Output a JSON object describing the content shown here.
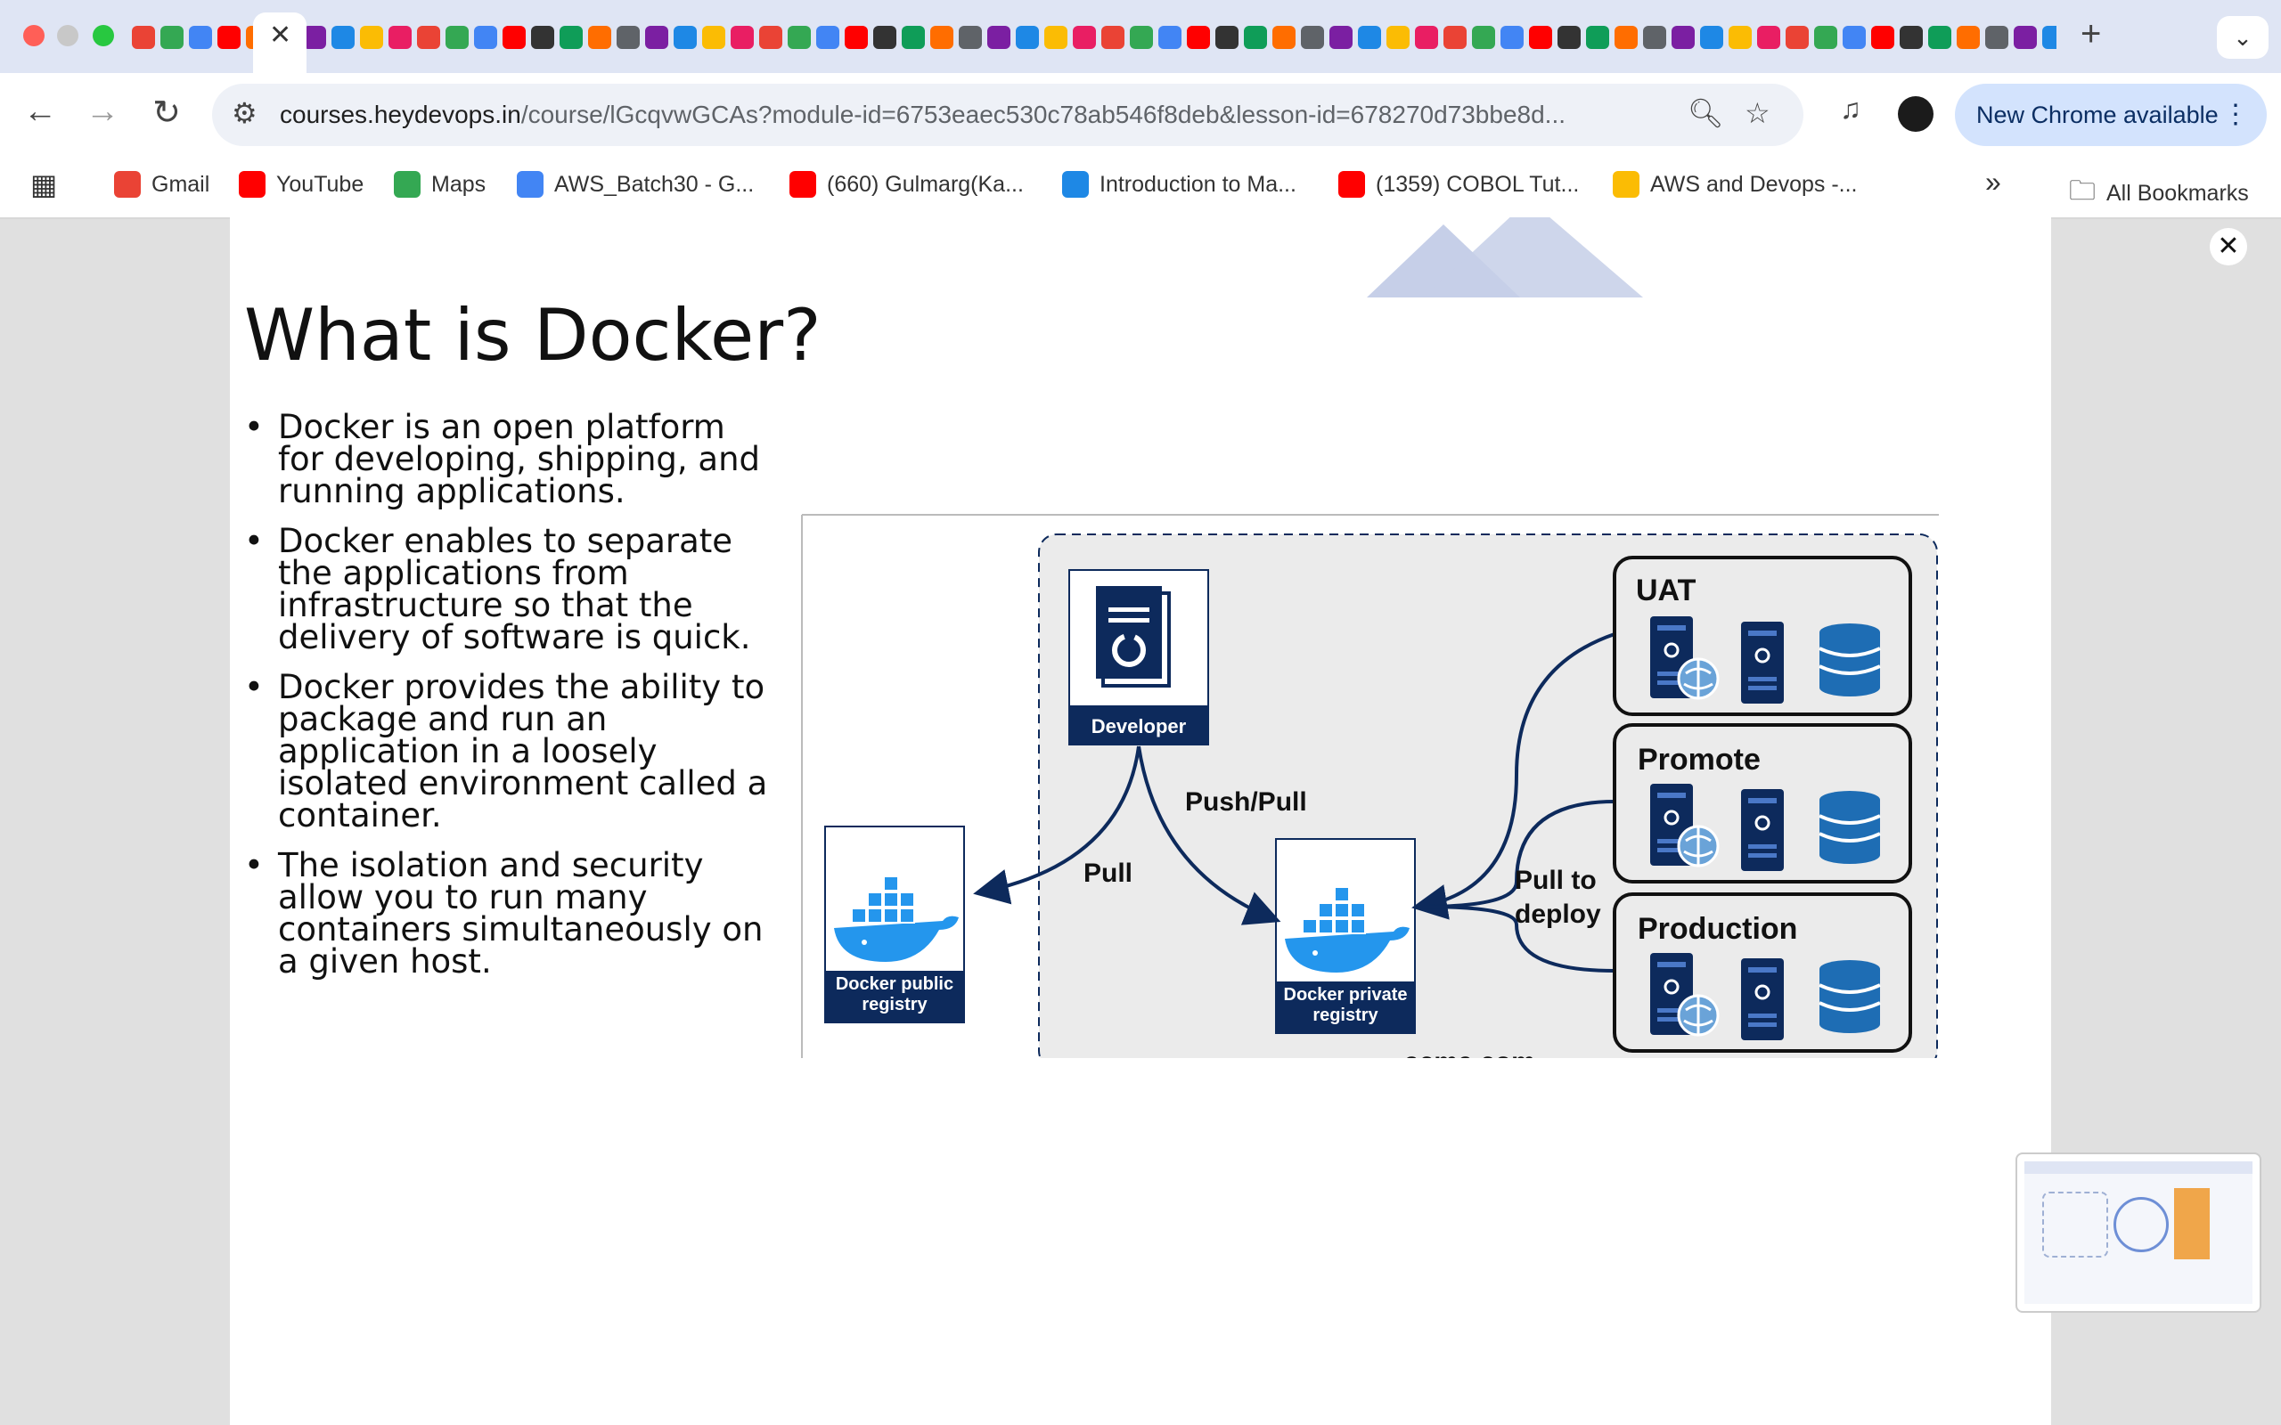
{
  "browser": {
    "tab_close": "✕",
    "new_tab": "+",
    "tab_menu": "⌄",
    "url_host": "courses.heydevops.in",
    "url_path": "/course/lGcqvwGCAs?module-id=6753eaec530c78ab546f8deb&lesson-id=678270d73bbe8d...",
    "new_chrome": "New Chrome available",
    "bookmarks": [
      {
        "label": "Gmail",
        "color": "#ea4335"
      },
      {
        "label": "YouTube",
        "color": "#ff0000"
      },
      {
        "label": "Maps",
        "color": "#34a853"
      },
      {
        "label": "AWS_Batch30 - G...",
        "color": "#4285f4"
      },
      {
        "label": "(660) Gulmarg(Ka...",
        "color": "#ff0000"
      },
      {
        "label": "Introduction to Ma...",
        "color": "#1e88e5"
      },
      {
        "label": "(1359) COBOL Tut...",
        "color": "#ff0000"
      },
      {
        "label": "AWS and Devops -...",
        "color": "#fbbc04"
      }
    ],
    "all_bookmarks": "All Bookmarks",
    "overflow": "»"
  },
  "slide": {
    "title": "What is Docker?",
    "bullets": [
      "Docker is an open platform for developing, shipping, and running applications.",
      "Docker enables to separate the applications from infrastructure so that the delivery of software is quick.",
      "Docker provides the ability to package and run an application in a loosely isolated environment called a container.",
      "The isolation and security allow you to run many containers simultaneously on a given host."
    ],
    "bullet_symbol": "•",
    "close": "✕"
  },
  "diagram": {
    "developer": "Developer",
    "push_pull": "Push/Pull",
    "pull": "Pull",
    "pull_to_deploy_1": "Pull to",
    "pull_to_deploy_2": "deploy",
    "public_registry_1": "Docker public",
    "public_registry_2": "registry",
    "private_registry_1": "Docker private",
    "private_registry_2": "registry",
    "env_uat": "UAT",
    "env_promote": "Promote",
    "env_production": "Production",
    "footer_partial": "acme.com",
    "colors": {
      "navy": "#0d2a5c",
      "whale": "#2496ed",
      "panel": "#ebebeb"
    }
  }
}
